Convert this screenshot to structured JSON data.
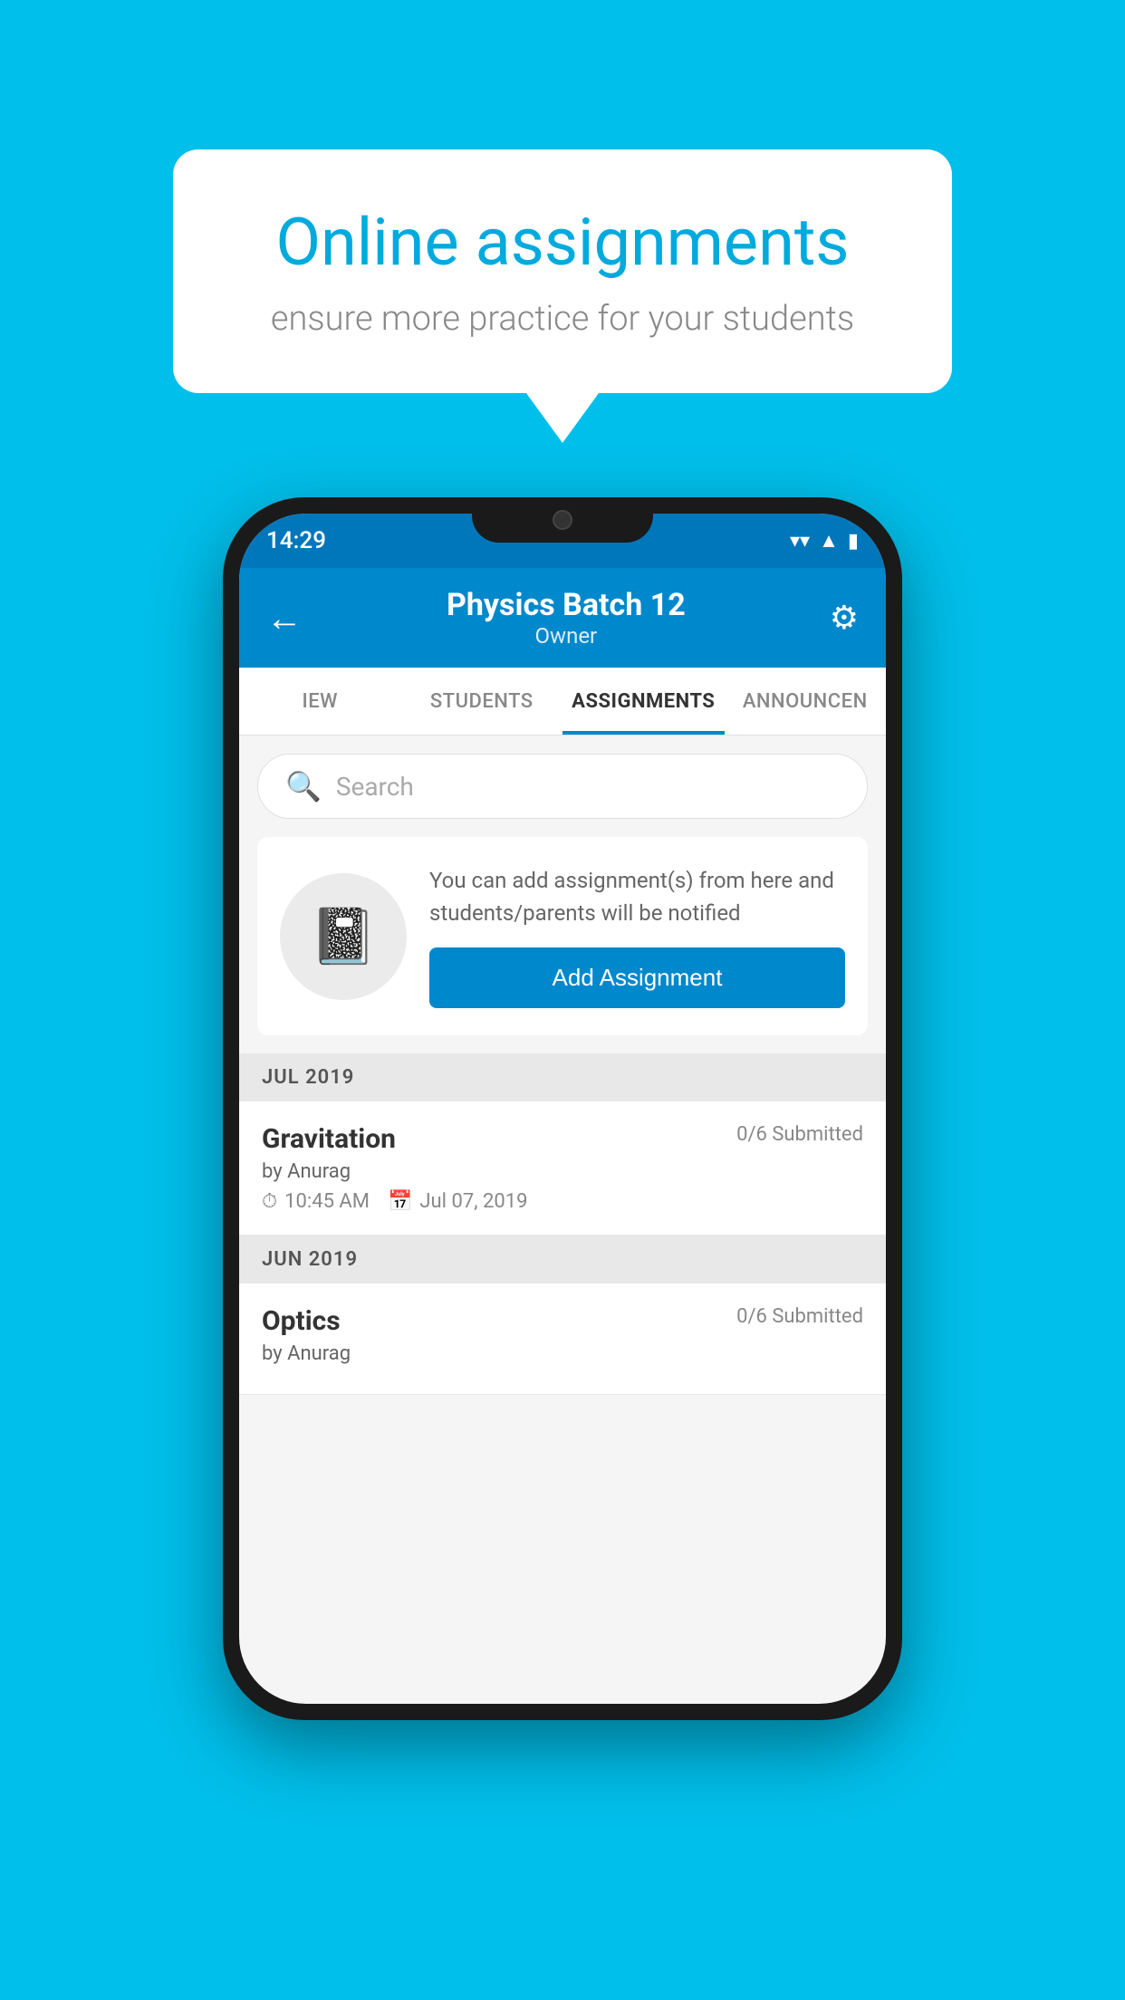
{
  "background_color": "#00BFEA",
  "speech_bubble": {
    "title": "Online assignments",
    "subtitle": "ensure more practice for your students"
  },
  "status_bar": {
    "time": "14:29",
    "wifi_icon": "▼",
    "signal_icon": "◀",
    "battery_icon": "▮"
  },
  "header": {
    "title": "Physics Batch 12",
    "subtitle": "Owner",
    "back_icon": "←",
    "settings_icon": "⚙"
  },
  "tabs": [
    {
      "id": "view",
      "label": "IEW",
      "active": false
    },
    {
      "id": "students",
      "label": "STUDENTS",
      "active": false
    },
    {
      "id": "assignments",
      "label": "ASSIGNMENTS",
      "active": true
    },
    {
      "id": "announcements",
      "label": "ANNOUNCEN",
      "active": false
    }
  ],
  "search": {
    "placeholder": "Search"
  },
  "empty_state": {
    "description": "You can add assignment(s) from here and students/parents will be notified",
    "button_label": "Add Assignment"
  },
  "sections": [
    {
      "month": "JUL 2019",
      "assignments": [
        {
          "name": "Gravitation",
          "submitted": "0/6 Submitted",
          "by": "by Anurag",
          "time": "10:45 AM",
          "date": "Jul 07, 2019"
        }
      ]
    },
    {
      "month": "JUN 2019",
      "assignments": [
        {
          "name": "Optics",
          "submitted": "0/6 Submitted",
          "by": "by Anurag",
          "time": "",
          "date": ""
        }
      ]
    }
  ]
}
